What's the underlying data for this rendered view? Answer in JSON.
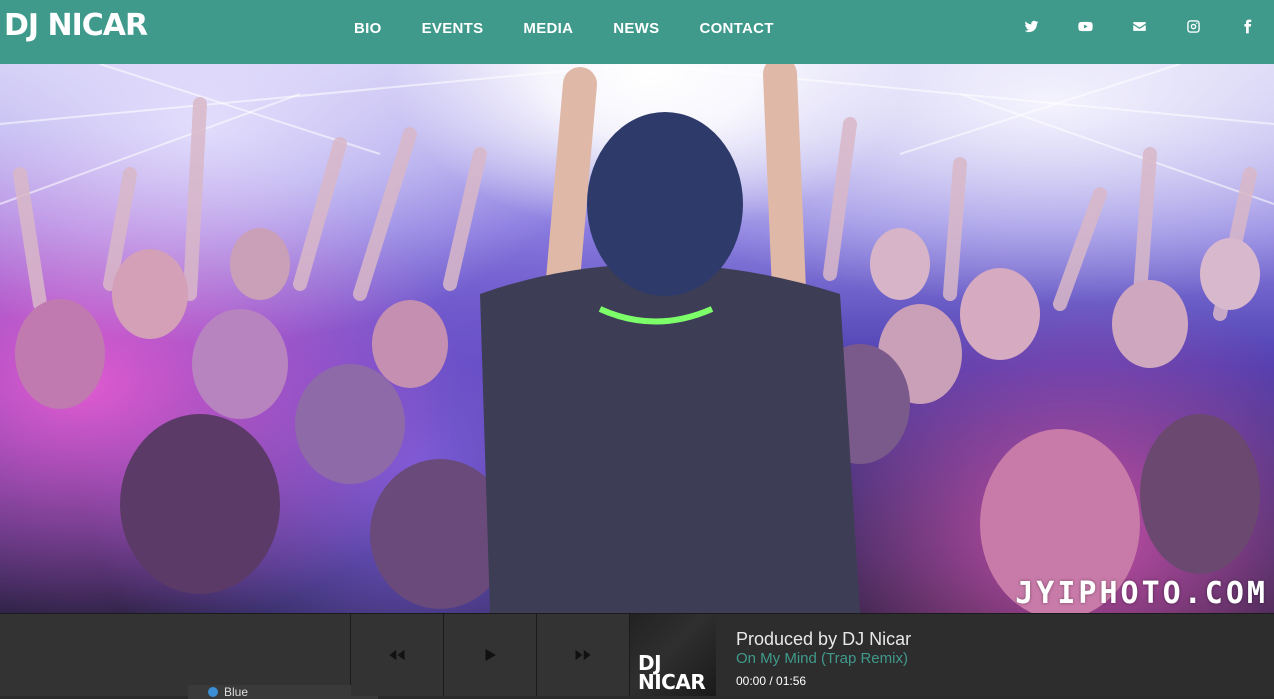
{
  "header": {
    "logo_text": "DJ NICAR",
    "nav": [
      {
        "label": "BIO"
      },
      {
        "label": "EVENTS"
      },
      {
        "label": "MEDIA"
      },
      {
        "label": "NEWS"
      },
      {
        "label": "CONTACT"
      }
    ],
    "social_icons": [
      "twitter-icon",
      "youtube-icon",
      "envelope-icon",
      "instagram-icon",
      "facebook-icon"
    ],
    "background_color": "#3f9a8c"
  },
  "hero": {
    "watermark": "JYIPHOTO.COM"
  },
  "player": {
    "title": "Produced by DJ Nicar",
    "track": "On My Mind (Trap Remix)",
    "time": "00:00 / 01:56",
    "cover_text_line1": "DJ",
    "cover_text_line2": "NICAR",
    "peek_label": "Blue",
    "accent_color": "#3f9a8c"
  }
}
